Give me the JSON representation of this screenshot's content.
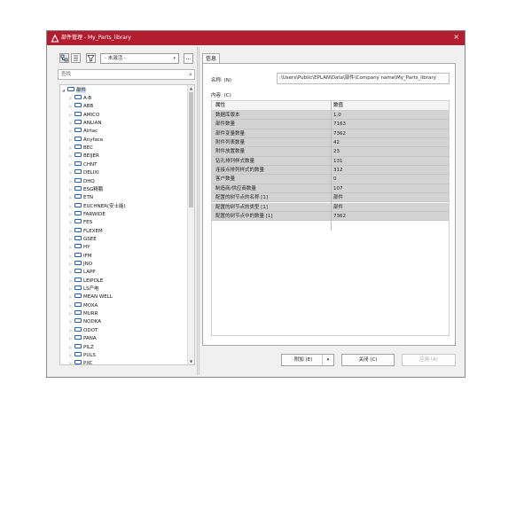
{
  "window": {
    "title": "部件管理 - My_Parts_library",
    "close_glyph": "×"
  },
  "toolbar": {
    "filter_value": "- 未激活 -",
    "more_label": "...",
    "search_placeholder": "查找"
  },
  "tree": {
    "root": "部件",
    "items": [
      "A-B",
      "ABB",
      "AMICO",
      "ANLIAN",
      "Airtac",
      "Anyface",
      "BEC",
      "BEIJER",
      "CHNT",
      "DELIXI",
      "DHQ",
      "ESG精鹏",
      "ETN",
      "EUCHNER(安士能)",
      "FARWIDE",
      "FES",
      "FLEXEM",
      "GSEE",
      "HY",
      "IFM",
      "JNO",
      "LAPP",
      "LEIPOLE",
      "LS产电",
      "MEAN WELL",
      "MOXA",
      "MURR",
      "NODKA",
      "ODOT",
      "PANA",
      "PILZ",
      "PULS",
      "PXC"
    ]
  },
  "info_tab": {
    "tab_label": "信息",
    "name_label": "名称: (N)",
    "path_value": ":\\Users\\Public\\EPLAN\\Data\\部件\\Company name\\My_Parts_library",
    "content_label": "内容: (C)",
    "columns": [
      "属性",
      "数值"
    ],
    "rows": [
      [
        "数据库版本",
        "1.0"
      ],
      [
        "部件数量",
        "7163"
      ],
      [
        "部件变量数量",
        "7362"
      ],
      [
        "附件列表数量",
        "42"
      ],
      [
        "附件放置数量",
        "23"
      ],
      [
        "钻孔排列样式数量",
        "131"
      ],
      [
        "连接点排列样式的数量",
        "312"
      ],
      [
        "客户数量",
        "0"
      ],
      [
        "制造商/供应商数量",
        "107"
      ],
      [
        "配置的树节点的名称 [1]",
        "部件"
      ],
      [
        "配置的树节点的类型 [1]",
        "部件"
      ],
      [
        "配置的树节点中的数量 [1]",
        "7362"
      ]
    ]
  },
  "buttons": {
    "attach": "附加 (E)",
    "close": "关闭 (C)",
    "apply": "应用 (A)"
  },
  "colors": {
    "titlebar": "#b21d2f",
    "grid_row": "#d3d3d3",
    "folder": "#2c5fa8"
  }
}
